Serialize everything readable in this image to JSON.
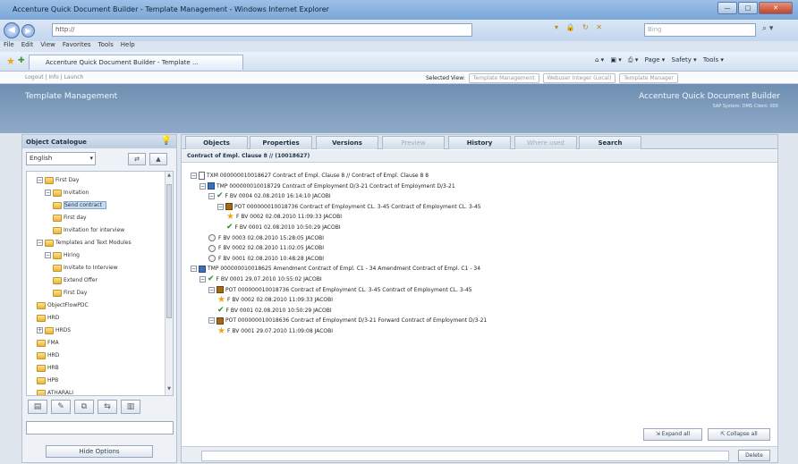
{
  "window": {
    "title": "Accenture Quick Document Builder - Template Management - Windows Internet Explorer",
    "min_label": "—",
    "max_label": "□",
    "close_label": "✕"
  },
  "address_bar": {
    "url": "http://",
    "search_placeholder": "Bing"
  },
  "menu": [
    "File",
    "Edit",
    "View",
    "Favorites",
    "Tools",
    "Help"
  ],
  "favorites_tab": "Accenture Quick Document Builder - Template ...",
  "command_bar": [
    "Page ▾",
    "Safety ▾",
    "Tools ▾"
  ],
  "app_header": {
    "links": "Logout  |  Info  |  Launch",
    "selected_view_label": "Selected View:",
    "selected_view": "Template Management",
    "user": "Webuser Integer (Local)",
    "role": "Template Manager"
  },
  "banner": {
    "title": "Template Management",
    "brand": "Accenture Quick Document Builder",
    "version": "SAP System: DMS Client: 000"
  },
  "left_panel": {
    "header": "Object Catalogue",
    "language": "English",
    "tree": [
      {
        "label": "First Day",
        "indent": 1,
        "toggle": "⊟"
      },
      {
        "label": "Invitation",
        "indent": 2,
        "toggle": "⊟"
      },
      {
        "label": "Send contract",
        "indent": 3,
        "toggle": "",
        "selected": true
      },
      {
        "label": "First day",
        "indent": 3,
        "toggle": ""
      },
      {
        "label": "Invitation for interview",
        "indent": 3,
        "toggle": ""
      },
      {
        "label": "Templates and Text Modules",
        "indent": 1,
        "toggle": "⊟"
      },
      {
        "label": "Hiring",
        "indent": 2,
        "toggle": "⊟"
      },
      {
        "label": "Invitate to Interview",
        "indent": 3,
        "toggle": ""
      },
      {
        "label": "Extend Offer",
        "indent": 3,
        "toggle": ""
      },
      {
        "label": "First Day",
        "indent": 3,
        "toggle": ""
      },
      {
        "label": "ObjectFlowPDC",
        "indent": 1,
        "toggle": ""
      },
      {
        "label": "HRD",
        "indent": 1,
        "toggle": ""
      },
      {
        "label": "HRDS",
        "indent": 1,
        "toggle": "⊞"
      },
      {
        "label": "FMA",
        "indent": 1,
        "toggle": ""
      },
      {
        "label": "HRD",
        "indent": 1,
        "toggle": ""
      },
      {
        "label": "HRB",
        "indent": 1,
        "toggle": ""
      },
      {
        "label": "HPB",
        "indent": 1,
        "toggle": ""
      },
      {
        "label": "ATHARALI",
        "indent": 1,
        "toggle": ""
      }
    ],
    "hide_options": "Hide Options"
  },
  "tabs": [
    {
      "label": "Objects",
      "disabled": false
    },
    {
      "label": "Properties",
      "disabled": false
    },
    {
      "label": "Versions",
      "disabled": false
    },
    {
      "label": "Preview",
      "disabled": true
    },
    {
      "label": "History",
      "disabled": false
    },
    {
      "label": "Where used",
      "disabled": true
    },
    {
      "label": "Search",
      "disabled": false
    }
  ],
  "breadcrumb": "Contract of Empl. Clause 8 // (10018627)",
  "rows": [
    {
      "indent": 0,
      "toggle": "⊟",
      "icon": "doc",
      "text": "TXM  000000010018627 Contract of Empl. Clause 8 // Contract of Empl. Clause 8 8"
    },
    {
      "indent": 1,
      "toggle": "⊟",
      "icon": "tmp",
      "text": "TMP  000000010018729 Contract of Employment D/3-21 Contract of Employment D/3-21"
    },
    {
      "indent": 2,
      "toggle": "⊟",
      "icon": "chk",
      "text": "F   BV 0004 02.08.2010 16:14:10 JACOBI"
    },
    {
      "indent": 3,
      "toggle": "⊟",
      "icon": "pot",
      "text": "POT  000000010018736 Contract of Employment CL. 3-45 Contract of Employment CL. 3-45"
    },
    {
      "indent": 4,
      "toggle": "",
      "icon": "star",
      "text": "F   BV 0002 02.08.2010 11:09:33 JACOBI"
    },
    {
      "indent": 4,
      "toggle": "",
      "icon": "chk",
      "text": "F   BV 0001 02.08.2010 10:50:29 JACOBI"
    },
    {
      "indent": 2,
      "toggle": "",
      "icon": "clk",
      "text": "F   BV 0003 02.08.2010 15:28:05 JACOBI"
    },
    {
      "indent": 2,
      "toggle": "",
      "icon": "clk",
      "text": "F   BV 0002 02.08.2010 11:02:05 JACOBI"
    },
    {
      "indent": 2,
      "toggle": "",
      "icon": "clk",
      "text": "F   BV 0001 02.08.2010 10:48:28 JACOBI"
    },
    {
      "indent": 0,
      "toggle": "⊟",
      "icon": "tmp",
      "text": "TMP  000000010018625 Amendment Contract of Empl. C1 - 34 Amendment Contract of Empl. C1 - 34"
    },
    {
      "indent": 1,
      "toggle": "⊟",
      "icon": "chk",
      "text": "F   BV 0001 29.07.2010 10:55:02 JACOBI"
    },
    {
      "indent": 2,
      "toggle": "⊟",
      "icon": "pot",
      "text": "POT  000000010018736 Contract of Employment CL. 3-45 Contract of Employment CL. 3-45"
    },
    {
      "indent": 3,
      "toggle": "",
      "icon": "star",
      "text": "F   BV 0002 02.08.2010 11:09:33 JACOBI"
    },
    {
      "indent": 3,
      "toggle": "",
      "icon": "chk",
      "text": "F   BV 0001 02.08.2010 10:50:29 JACOBI"
    },
    {
      "indent": 2,
      "toggle": "⊟",
      "icon": "pot",
      "text": "POT  000000010018636 Contract of Employment D/3-21 Forward Contract of Employment D/3-21"
    },
    {
      "indent": 3,
      "toggle": "",
      "icon": "star",
      "text": "F   BV 0001 29.07.2010 11:09:08 JACOBI"
    }
  ],
  "buttons": {
    "expand_all": "⇲ Expand all",
    "collapse_all": "⇱ Collapse all",
    "delete": "Delete"
  }
}
